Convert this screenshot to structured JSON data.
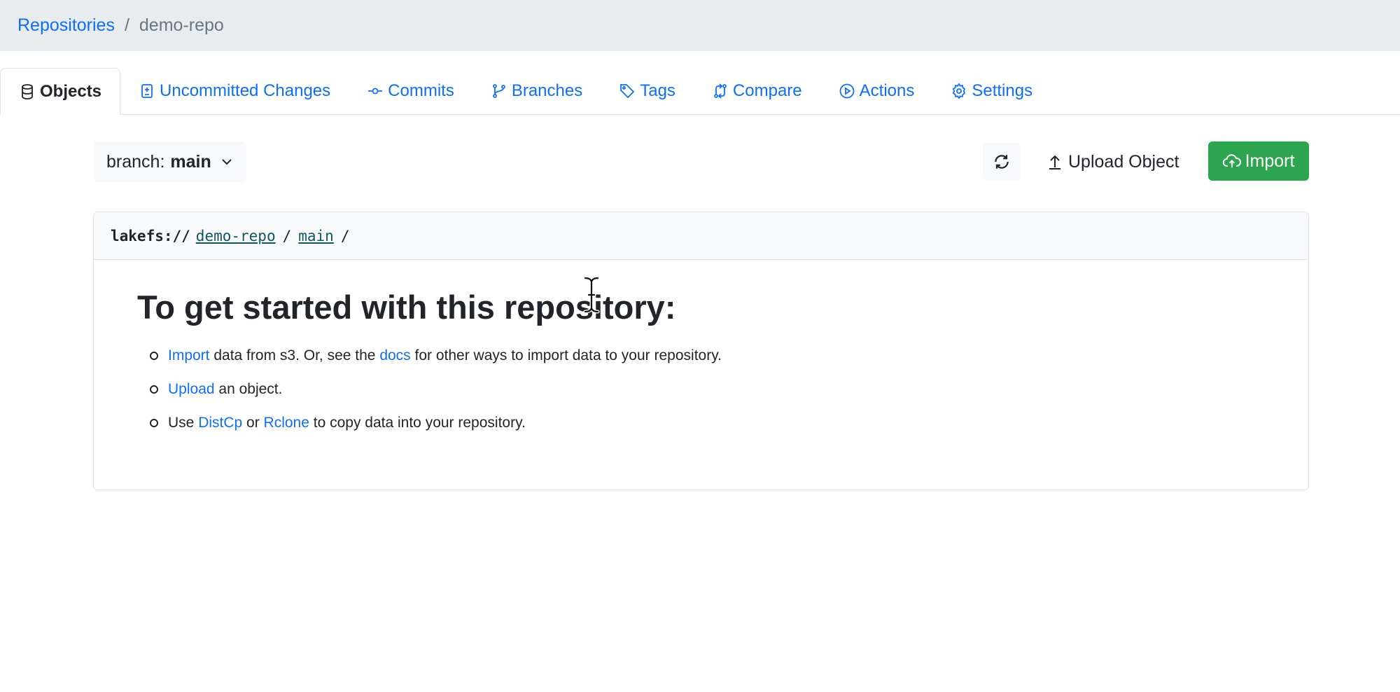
{
  "breadcrumb": {
    "root": "Repositories",
    "separator": "/",
    "current": "demo-repo"
  },
  "tabs": [
    {
      "label": "Objects",
      "icon": "database-icon",
      "active": true
    },
    {
      "label": "Uncommitted Changes",
      "icon": "file-diff-icon",
      "active": false
    },
    {
      "label": "Commits",
      "icon": "git-commit-icon",
      "active": false
    },
    {
      "label": "Branches",
      "icon": "git-branch-icon",
      "active": false
    },
    {
      "label": "Tags",
      "icon": "tag-icon",
      "active": false
    },
    {
      "label": "Compare",
      "icon": "git-compare-icon",
      "active": false
    },
    {
      "label": "Actions",
      "icon": "play-circle-icon",
      "active": false
    },
    {
      "label": "Settings",
      "icon": "gear-icon",
      "active": false
    }
  ],
  "toolbar": {
    "branch_prefix": "branch:",
    "branch_name": "main",
    "upload_label": "Upload Object",
    "import_label": "Import"
  },
  "path": {
    "protocol": "lakefs://",
    "repo": "demo-repo",
    "sep": "/",
    "branch": "main",
    "trailing": "/"
  },
  "getting_started": {
    "title": "To get started with this repository:",
    "step1": {
      "link1": "Import",
      "text1": " data from s3. Or, see the ",
      "link2": "docs",
      "text2": " for other ways to import data to your repository."
    },
    "step2": {
      "link1": "Upload",
      "text1": " an object."
    },
    "step3": {
      "text0": "Use ",
      "link1": "DistCp",
      "text1": " or ",
      "link2": "Rclone",
      "text2": " to copy data into your repository."
    }
  },
  "colors": {
    "link": "#0d6efd",
    "import_button": "#2da44e",
    "breadcrumb_bg": "#e9ecef"
  }
}
